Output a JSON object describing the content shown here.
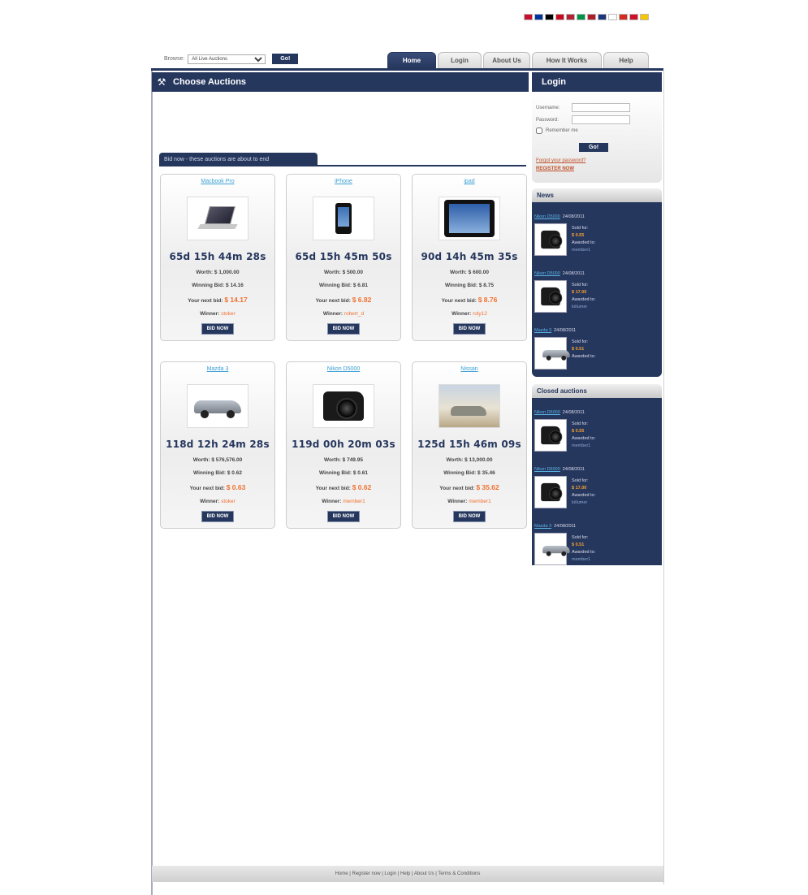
{
  "flags": [
    "#c8102e",
    "#003399",
    "#000000",
    "#c60b1e",
    "#b22234",
    "#009246",
    "#ae1c28",
    "#1c3578",
    "#ffffff",
    "#d52b1e",
    "#ce1126",
    "#f7c600"
  ],
  "browse": {
    "label": "Browse:",
    "select_value": "All Live Auctions",
    "go_label": "Go!"
  },
  "tabs": [
    {
      "label": "Home",
      "active": true
    },
    {
      "label": "Login",
      "active": false
    },
    {
      "label": "About Us",
      "active": false
    },
    {
      "label": "How It Works",
      "active": false
    },
    {
      "label": "Help",
      "active": false
    }
  ],
  "main": {
    "title": "Choose Auctions",
    "bidnow_title": "Bid now - these auctions are about to end"
  },
  "auctions": [
    {
      "name": "Macbook Pro",
      "timer": "65d 15h 44m 28s",
      "worth": "Worth: $ 1,000.00",
      "winning": "Winning Bid: $ 14.16",
      "next_label": "Your next bid:",
      "next": "$ 14.17",
      "winner_label": "Winner:",
      "winner": "stoker",
      "bid": "BID NOW",
      "image": "laptop"
    },
    {
      "name": "iPhone",
      "timer": "65d 15h 45m 50s",
      "worth": "Worth: $ 500.00",
      "winning": "Winning Bid: $ 6.81",
      "next_label": "Your next bid:",
      "next": "$ 6.82",
      "winner_label": "Winner:",
      "winner": "robert_d",
      "bid": "BID NOW",
      "image": "phone"
    },
    {
      "name": "ipad",
      "timer": "90d 14h 45m 35s",
      "worth": "Worth: $ 600.00",
      "winning": "Winning Bid: $ 8.75",
      "next_label": "Your next bid:",
      "next": "$ 8.76",
      "winner_label": "Winner:",
      "winner": "roly12",
      "bid": "BID NOW",
      "image": "tablet"
    },
    {
      "name": "Mazda 3",
      "timer": "118d 12h 24m 28s",
      "worth": "Worth: $ 576,576.00",
      "winning": "Winning Bid: $ 0.62",
      "next_label": "Your next bid:",
      "next": "$ 0.63",
      "winner_label": "Winner:",
      "winner": "stoker",
      "bid": "BID NOW",
      "image": "car"
    },
    {
      "name": "Nikon D5000",
      "timer": "119d 00h 20m 03s",
      "worth": "Worth: $ 749.95",
      "winning": "Winning Bid: $ 0.61",
      "next_label": "Your next bid:",
      "next": "$ 0.62",
      "winner_label": "Winner:",
      "winner": "member1",
      "bid": "BID NOW",
      "image": "camera"
    },
    {
      "name": "Nissan",
      "timer": "125d 15h 46m 09s",
      "worth": "Worth: $ 13,000.00",
      "winning": "Winning Bid: $ 35.46",
      "next_label": "Your next bid:",
      "next": "$ 35.62",
      "winner_label": "Winner:",
      "winner": "member1",
      "bid": "BID NOW",
      "image": "photo-car"
    }
  ],
  "login": {
    "title": "Login",
    "username_label": "Username:",
    "password_label": "Password:",
    "remember_label": "Remember me",
    "go_label": "Go!",
    "forgot": "Forgot your password?",
    "register": "REGISTER NOW"
  },
  "news": {
    "title": "News",
    "items": [
      {
        "link": "Nikon D5000",
        "date": "24/08/2011",
        "sold_label": "Sold for:",
        "price": "$ 0.55",
        "awarded_label": "Awarded to:",
        "awarded": "member1",
        "image": "camera"
      },
      {
        "link": "Nikon D5000",
        "date": "24/08/2011",
        "sold_label": "Sold for:",
        "price": "$ 17.00",
        "awarded_label": "Awarded to:",
        "awarded": "lollumer",
        "image": "camera"
      },
      {
        "link": "Mazda 3",
        "date": "24/08/2011",
        "sold_label": "Sold for:",
        "price": "$ 0.51",
        "awarded_label": "Awarded to:",
        "awarded": "",
        "image": "car"
      }
    ]
  },
  "closed": {
    "title": "Closed auctions",
    "items": [
      {
        "link": "Nikon D5000",
        "date": "24/08/2011",
        "sold_label": "Sold for:",
        "price": "$ 0.55",
        "awarded_label": "Awarded to:",
        "awarded": "member1",
        "image": "camera"
      },
      {
        "link": "Nikon D5000",
        "date": "24/08/2011",
        "sold_label": "Sold for:",
        "price": "$ 17.00",
        "awarded_label": "Awarded to:",
        "awarded": "lollumer",
        "image": "camera"
      },
      {
        "link": "Mazda 3",
        "date": "24/08/2011",
        "sold_label": "Sold for:",
        "price": "$ 0.51",
        "awarded_label": "Awarded to:",
        "awarded": "member1",
        "image": "car"
      }
    ]
  },
  "footer": {
    "text": "Home | Register now | Login | Help | About Us | Terms & Conditions"
  }
}
